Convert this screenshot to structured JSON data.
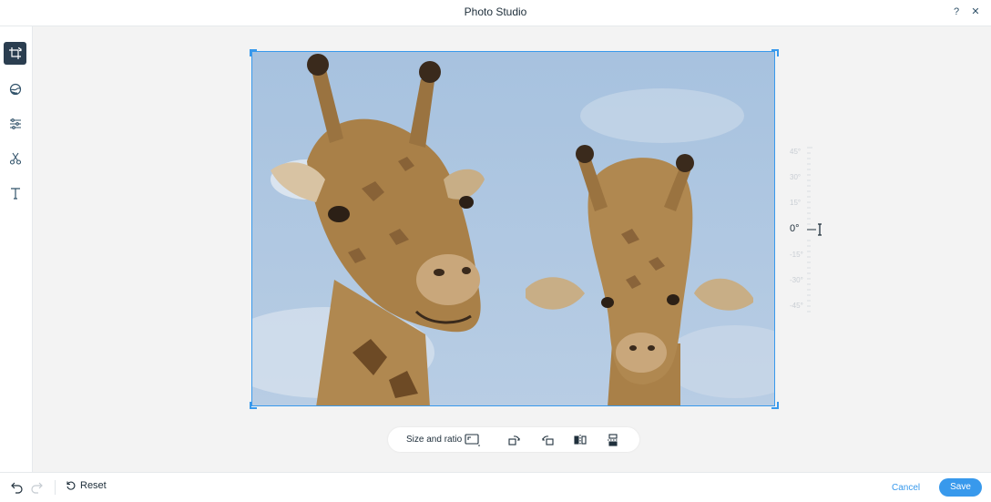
{
  "header": {
    "title": "Photo Studio",
    "help_label": "?",
    "close_label": "✕"
  },
  "sidebar": {
    "tools": [
      {
        "name": "crop-rotate",
        "active": true
      },
      {
        "name": "filters",
        "active": false
      },
      {
        "name": "adjust",
        "active": false
      },
      {
        "name": "cutout",
        "active": false
      },
      {
        "name": "text",
        "active": false
      }
    ]
  },
  "toolbar": {
    "size_ratio_label": "Size and ratio"
  },
  "ruler": {
    "ticks": [
      "45°",
      "30°",
      "15°",
      "0°",
      "-15°",
      "-30°",
      "-45°"
    ],
    "current": "0°"
  },
  "footer": {
    "reset_label": "Reset",
    "cancel_label": "Cancel",
    "save_label": "Save"
  },
  "colors": {
    "accent": "#3899ec",
    "active_tool_bg": "#2b3e50",
    "sky": "#a9c3df"
  }
}
